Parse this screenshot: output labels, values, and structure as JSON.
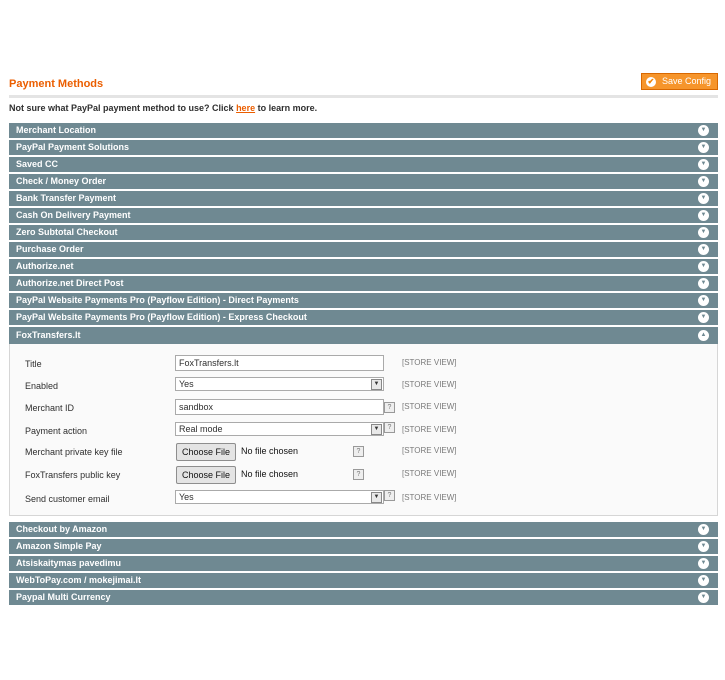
{
  "header": {
    "title": "Payment Methods",
    "save_label": "Save Config"
  },
  "hint": {
    "text": "Not sure what PayPal payment method to use? Click ",
    "link": "here",
    "suffix": " to learn more."
  },
  "sections_top": [
    {
      "label": "Merchant Location"
    },
    {
      "label": "PayPal Payment Solutions"
    },
    {
      "label": "Saved CC"
    },
    {
      "label": "Check / Money Order"
    },
    {
      "label": "Bank Transfer Payment"
    },
    {
      "label": "Cash On Delivery Payment"
    },
    {
      "label": "Zero Subtotal Checkout"
    },
    {
      "label": "Purchase Order"
    },
    {
      "label": "Authorize.net"
    },
    {
      "label": "Authorize.net Direct Post"
    },
    {
      "label": "PayPal Website Payments Pro (Payflow Edition) - Direct Payments"
    },
    {
      "label": "PayPal Website Payments Pro (Payflow Edition) - Express Checkout"
    }
  ],
  "open_section": {
    "label": "FoxTransfers.lt",
    "fields": {
      "title": {
        "label": "Title",
        "value": "FoxTransfers.lt",
        "scope": "[STORE VIEW]"
      },
      "enabled": {
        "label": "Enabled",
        "value": "Yes",
        "scope": "[STORE VIEW]"
      },
      "merchant_id": {
        "label": "Merchant ID",
        "value": "sandbox",
        "scope": "[STORE VIEW]",
        "help": "?"
      },
      "payment_action": {
        "label": "Payment action",
        "value": "Real mode",
        "scope": "[STORE VIEW]",
        "help": "?"
      },
      "private_key": {
        "label": "Merchant private key file",
        "button": "Choose File",
        "status": "No file chosen",
        "scope": "[STORE VIEW]",
        "help": "?"
      },
      "public_key": {
        "label": "FoxTransfers public key",
        "button": "Choose File",
        "status": "No file chosen",
        "scope": "[STORE VIEW]",
        "help": "?"
      },
      "send_email": {
        "label": "Send customer email",
        "value": "Yes",
        "scope": "[STORE VIEW]",
        "help": "?"
      }
    }
  },
  "sections_bottom": [
    {
      "label": "Checkout by Amazon"
    },
    {
      "label": "Amazon Simple Pay"
    },
    {
      "label": "Atsiskaitymas pavedimu"
    },
    {
      "label": "WebToPay.com / mokejimai.lt"
    },
    {
      "label": "Paypal Multi Currency"
    }
  ],
  "icons": {
    "expand": "chevron-down-icon",
    "collapse": "chevron-up-icon",
    "save": "check-circle-icon"
  },
  "colors": {
    "accent": "#eb5e00",
    "section_bg": "#6f8992",
    "button": "#f6952b"
  }
}
